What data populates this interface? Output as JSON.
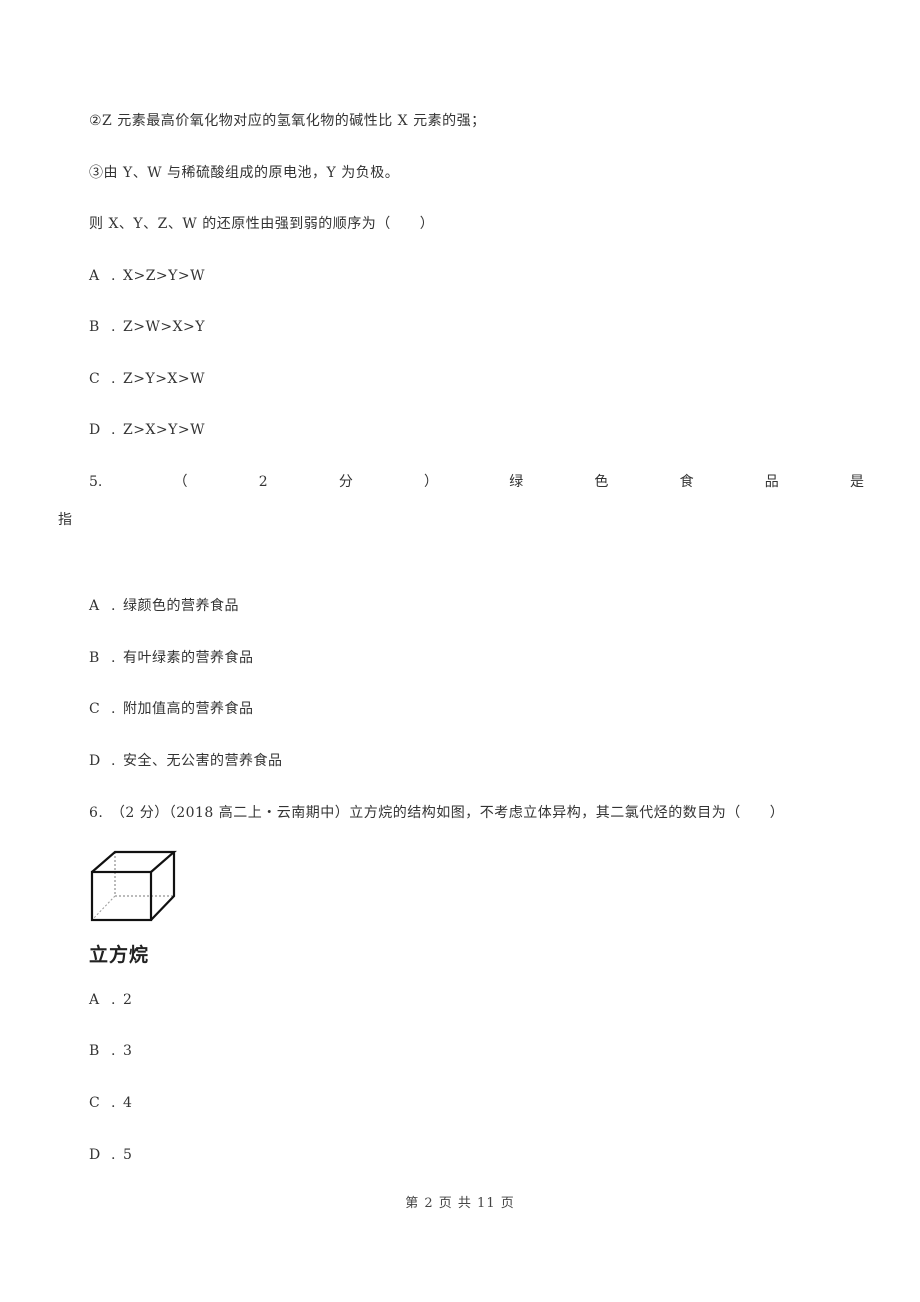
{
  "q4": {
    "condition_2": "②Z 元素最高价氧化物对应的氢氧化物的碱性比 X 元素的强；",
    "condition_3": "③由 Y、W 与稀硫酸组成的原电池，Y 为负极。",
    "question": "则 X、Y、Z、W 的还原性由强到弱的顺序为（　　）",
    "options": [
      {
        "label": "A",
        "text": "X>Z>Y>W"
      },
      {
        "label": "B",
        "text": "Z>W>X>Y"
      },
      {
        "label": "C",
        "text": "Z>Y>X>W"
      },
      {
        "label": "D",
        "text": "Z>X>Y>W"
      }
    ]
  },
  "q5": {
    "tokens": [
      "5.",
      "（",
      "2",
      "分",
      "）",
      "绿",
      "色",
      "食",
      "品",
      "是"
    ],
    "continuation": "指",
    "options": [
      {
        "label": "A",
        "text": "绿颜色的营养食品"
      },
      {
        "label": "B",
        "text": "有叶绿素的营养食品"
      },
      {
        "label": "C",
        "text": "附加值高的营养食品"
      },
      {
        "label": "D",
        "text": "安全、无公害的营养食品"
      }
    ]
  },
  "q6": {
    "stem": "6.　（2 分）（2018 高二上・云南期中）立方烷的结构如图，不考虑立体异构，其二氯代烃的数目为（　　）",
    "figure_caption": "立方烷",
    "options": [
      {
        "label": "A",
        "text": "2"
      },
      {
        "label": "B",
        "text": "3"
      },
      {
        "label": "C",
        "text": "4"
      },
      {
        "label": "D",
        "text": "5"
      }
    ]
  },
  "footer": {
    "page_text": "第 2 页 共 11 页"
  }
}
